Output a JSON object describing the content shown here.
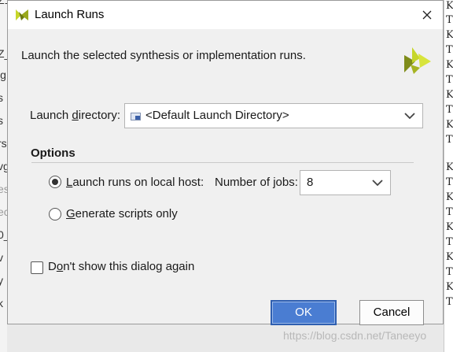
{
  "title_bar": {
    "title": "Launch Runs"
  },
  "header": {
    "description": "Launch the selected synthesis or implementation runs."
  },
  "launch_directory": {
    "label_pre": "Launch ",
    "label_mnemonic": "d",
    "label_post": "irectory:",
    "value": "<Default Launch Directory>"
  },
  "options": {
    "title": "Options",
    "local_host": {
      "label_mnemonic": "L",
      "label_post": "aunch runs on local host:",
      "checked": true
    },
    "jobs": {
      "label_pre": "Number of ",
      "label_mnemonic": "j",
      "label_post": "obs:",
      "value": "8"
    },
    "scripts_only": {
      "label_mnemonic": "G",
      "label_post": "enerate scripts only",
      "checked": false
    }
  },
  "dont_show": {
    "label_pre": "D",
    "label_mnemonic": "o",
    "label_post": "n't show this dialog again",
    "checked": false
  },
  "buttons": {
    "ok": "OK",
    "cancel": "Cancel"
  },
  "background": {
    "left_fragments": [
      "Z1",
      "Z_",
      "ig",
      "s",
      "s",
      "rs",
      "vg",
      "es",
      "ec",
      "0_",
      "v",
      "y",
      "k"
    ],
    "right_fragments": [
      "K",
      "T",
      "K",
      "T",
      "K",
      "T",
      "K",
      "T",
      "K",
      "T",
      "K",
      "T",
      "K",
      "T",
      "K",
      "T",
      "K",
      "T",
      "K",
      "T"
    ],
    "watermark": "https://blog.csdn.net/Taneeyo"
  },
  "colors": {
    "dialog_bg": "#f0f0f0",
    "ok_button": "#4a7dd2",
    "brand_yellow_green": "#c6d62a",
    "brand_dark": "#7a7a1a"
  },
  "icons": {
    "title_logo": "vivado-logo-icon",
    "brand_logo": "vivado-logo-icon",
    "close": "close-icon",
    "folder": "folder-icon",
    "dropdown": "chevron-down-icon"
  }
}
